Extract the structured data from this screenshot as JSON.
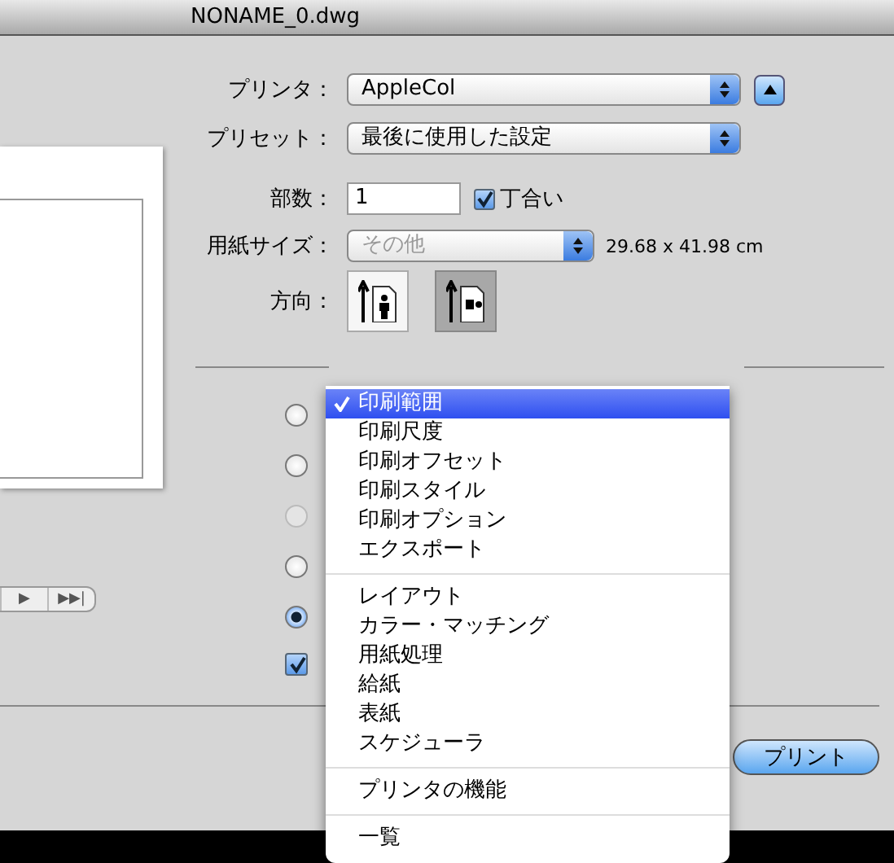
{
  "window": {
    "title": "NONAME_0.dwg"
  },
  "form": {
    "printer": {
      "label": "プリンタ：",
      "value": "AppleCol"
    },
    "preset": {
      "label": "プリセット：",
      "value": "最後に使用した設定"
    },
    "copies": {
      "label": "部数：",
      "value": "1",
      "collate": {
        "label": "丁合い",
        "checked": true
      }
    },
    "paper_size": {
      "label": "用紙サイズ：",
      "value": "その他",
      "disabled": true,
      "dimensions": "29.68 x 41.98 cm"
    },
    "orientation": {
      "label": "方向：",
      "options": [
        {
          "kind": "portrait",
          "selected": false
        },
        {
          "kind": "landscape",
          "selected": true
        }
      ]
    }
  },
  "radios": [
    {
      "selected": false,
      "disabled": false
    },
    {
      "selected": false,
      "disabled": false
    },
    {
      "selected": false,
      "disabled": true
    },
    {
      "selected": false,
      "disabled": false
    },
    {
      "selected": true,
      "disabled": false
    }
  ],
  "checkbox": {
    "checked": true
  },
  "pager": [
    "▶",
    "▶▶|"
  ],
  "buttons": [
    {
      "label": "プリント",
      "kind": "default"
    }
  ],
  "menu": {
    "groups": [
      [
        {
          "label": "印刷範囲",
          "selected": true
        },
        {
          "label": "印刷尺度",
          "selected": false
        },
        {
          "label": "印刷オフセット",
          "selected": false
        },
        {
          "label": "印刷スタイル",
          "selected": false
        },
        {
          "label": "印刷オプション",
          "selected": false
        },
        {
          "label": "エクスポート",
          "selected": false
        }
      ],
      [
        {
          "label": "レイアウト",
          "selected": false
        },
        {
          "label": "カラー・マッチング",
          "selected": false
        },
        {
          "label": "用紙処理",
          "selected": false
        },
        {
          "label": "給紙",
          "selected": false
        },
        {
          "label": "表紙",
          "selected": false
        },
        {
          "label": "スケジューラ",
          "selected": false
        }
      ],
      [
        {
          "label": "プリンタの機能",
          "selected": false
        }
      ],
      [
        {
          "label": "一覧",
          "selected": false
        }
      ]
    ]
  }
}
